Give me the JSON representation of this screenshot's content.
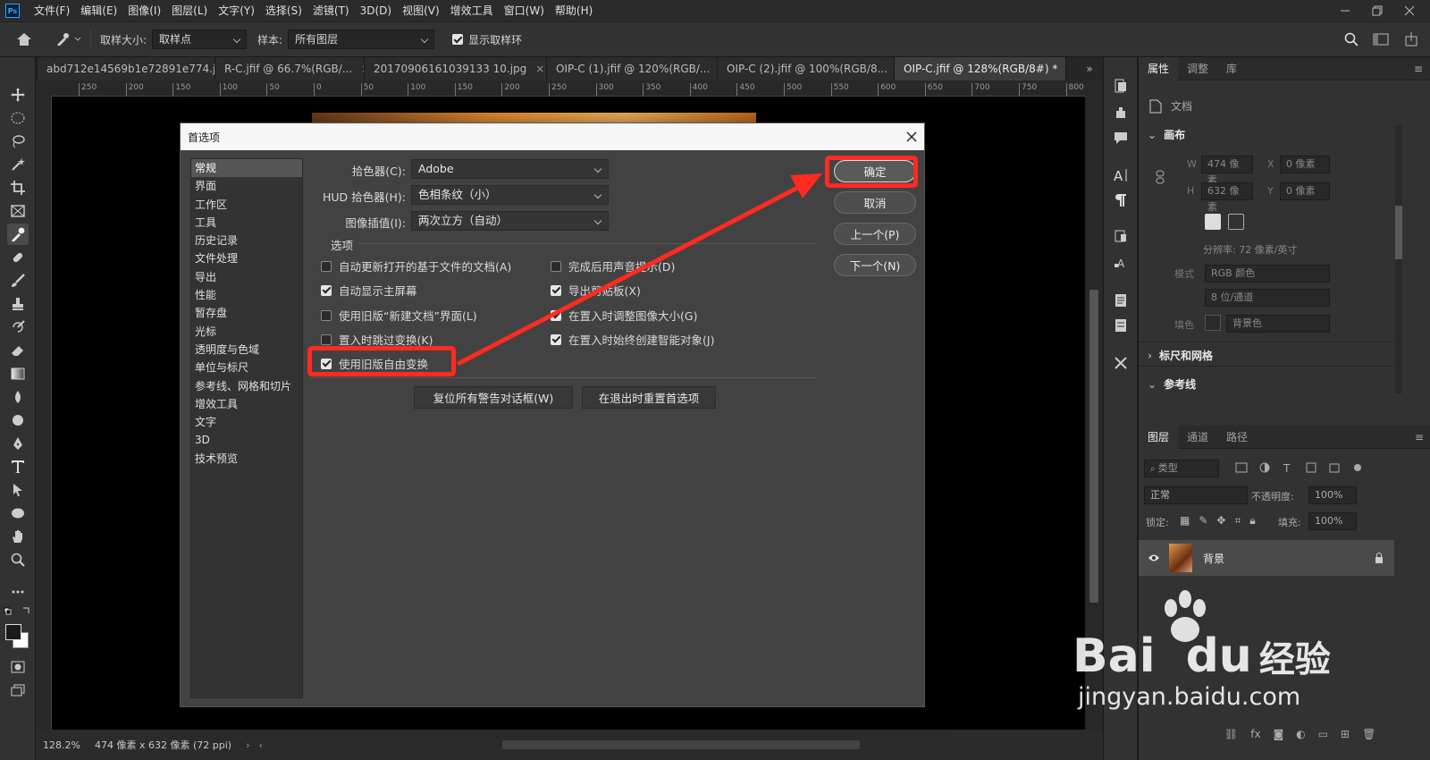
{
  "menubar": {
    "items": [
      "文件(F)",
      "编辑(E)",
      "图像(I)",
      "图层(L)",
      "文字(Y)",
      "选择(S)",
      "滤镜(T)",
      "3D(D)",
      "视图(V)",
      "增效工具",
      "窗口(W)",
      "帮助(H)"
    ]
  },
  "options_bar": {
    "sample_size_label": "取样大小:",
    "sample_size_value": "取样点",
    "sample_label": "样本:",
    "sample_value": "所有图层",
    "show_ring_label": "显示取样环",
    "show_ring_checked": true
  },
  "tabs": [
    {
      "label": "abd712e14569b1e72891e774.jpg",
      "active": false
    },
    {
      "label": "R-C.jfif @ 66.7%(RGB/...",
      "active": false
    },
    {
      "label": "20170906161039133 10.jpg",
      "active": false
    },
    {
      "label": "OIP-C (1).jfif @ 120%(RGB/...",
      "active": false
    },
    {
      "label": "OIP-C (2).jfif @ 100%(RGB/8...",
      "active": false
    },
    {
      "label": "OIP-C.jfif @ 128%(RGB/8#) *",
      "active": true
    }
  ],
  "ruler_labels": [
    "250",
    "200",
    "150",
    "100",
    "50",
    "0",
    "50",
    "100",
    "150",
    "200",
    "250",
    "300",
    "350",
    "400",
    "450",
    "500",
    "550",
    "600",
    "650",
    "700",
    "750",
    "800"
  ],
  "statusbar": {
    "zoom": "128.2%",
    "doc_info": "474 像素 x 632 像素 (72 ppi)"
  },
  "properties": {
    "tabs": [
      "属性",
      "调整",
      "库"
    ],
    "doc_label": "文档",
    "canvas_title": "画布",
    "w_label": "W",
    "w_value": "474 像素",
    "h_label": "H",
    "h_value": "632 像素",
    "x_label": "X",
    "x_value": "0 像素",
    "y_label": "Y",
    "y_value": "0 像素",
    "resolution": "分辨率: 72 像素/英寸",
    "mode_label": "模式",
    "mode_value": "RGB 颜色",
    "depth_value": "8 位/通道",
    "fill_label": "填色",
    "fill_value": "背景色",
    "rulers_grid": "标尺和网格",
    "guides": "参考线"
  },
  "layers": {
    "tabs": [
      "图层",
      "通道",
      "路径"
    ],
    "kind_filter": "类型",
    "blend_mode": "正常",
    "opacity_label": "不透明度:",
    "opacity_value": "100%",
    "lock_label": "锁定:",
    "fill_label": "填充:",
    "fill_value": "100%",
    "layer_name": "背景"
  },
  "dialog": {
    "title": "首选项",
    "categories": [
      "常规",
      "界面",
      "工作区",
      "工具",
      "历史记录",
      "文件处理",
      "导出",
      "性能",
      "暂存盘",
      "光标",
      "透明度与色域",
      "单位与标尺",
      "参考线、网格和切片",
      "增效工具",
      "文字",
      "3D",
      "技术预览"
    ],
    "selected_category": "常规",
    "color_picker_label": "拾色器(C):",
    "color_picker_value": "Adobe",
    "hud_picker_label": "HUD 拾色器(H):",
    "hud_picker_value": "色相条纹（小）",
    "interp_label": "图像插值(I):",
    "interp_value": "两次立方（自动）",
    "options_title": "选项",
    "options_left": [
      {
        "label": "自动更新打开的基于文件的文档(A)",
        "checked": false
      },
      {
        "label": "自动显示主屏幕",
        "checked": true
      },
      {
        "label": "使用旧版“新建文档”界面(L)",
        "checked": false
      },
      {
        "label": "置入时跳过变换(K)",
        "checked": false
      },
      {
        "label": "使用旧版自由变换",
        "checked": true
      }
    ],
    "options_right": [
      {
        "label": "完成后用声音提示(D)",
        "checked": false
      },
      {
        "label": "导出剪贴板(X)",
        "checked": true
      },
      {
        "label": "在置入时调整图像大小(G)",
        "checked": true
      },
      {
        "label": "在置入时始终创建智能对象(J)",
        "checked": true
      }
    ],
    "reset_warnings": "复位所有警告对话框(W)",
    "reset_prefs": "在退出时重置首选项",
    "ok": "确定",
    "cancel": "取消",
    "prev": "上一个(P)",
    "next": "下一个(N)"
  },
  "annotation_color": "#ff2a20",
  "watermark": {
    "brand_latin": "Bai",
    "brand_latin2": "du",
    "brand_cn": "经验",
    "url": "jingyan.baidu.com"
  }
}
